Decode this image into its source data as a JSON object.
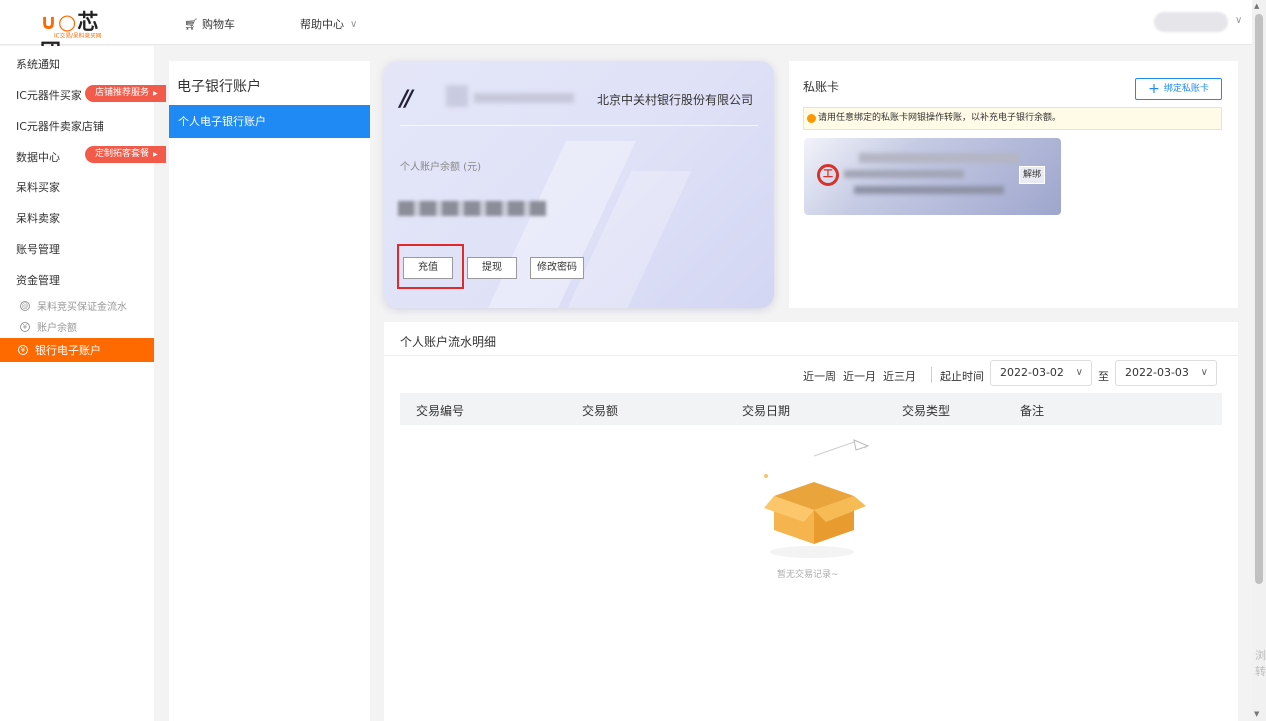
{
  "header": {
    "logo_text": "芯团",
    "logo_sub": "IC交易/呆料竞买网",
    "cart_label": "购物车",
    "help_label": "帮助中心"
  },
  "sidebar": {
    "items": [
      {
        "label": "系统通知"
      },
      {
        "label": "IC元器件买家",
        "tag": "店铺推荐服务"
      },
      {
        "label": "IC元器件卖家店铺"
      },
      {
        "label": "数据中心",
        "tag": "定制拓客套餐"
      },
      {
        "label": "呆料买家"
      },
      {
        "label": "呆料卖家"
      },
      {
        "label": "账号管理"
      },
      {
        "label": "资金管理"
      }
    ],
    "sub_items": [
      {
        "label": "呆料竞买保证金流水"
      },
      {
        "label": "账户余额"
      }
    ],
    "active_item": "银行电子账户"
  },
  "account_panel": {
    "title": "电子银行账户",
    "selected": "个人电子银行账户"
  },
  "card": {
    "bank_name": "北京中关村银行股份有限公司",
    "balance_label": "个人账户余额 (元)",
    "buttons": {
      "recharge": "充值",
      "withdraw": "提现",
      "change_password": "修改密码"
    }
  },
  "private_card": {
    "title": "私账卡",
    "bind_button": "绑定私账卡",
    "notice": "请用任意绑定的私账卡网银操作转账，以补充电子银行余额。",
    "unbind_button": "解绑"
  },
  "transactions": {
    "title": "个人账户流水明细",
    "quick_filters": [
      "近一周",
      "近一月",
      "近三月"
    ],
    "range_label": "起止时间",
    "start_date": "2022-03-02",
    "to_label": "至",
    "end_date": "2022-03-03",
    "columns": [
      "交易编号",
      "交易额",
      "交易日期",
      "交易类型",
      "备注"
    ],
    "empty_text": "暂无交易记录~"
  },
  "edge_text": "浏转"
}
